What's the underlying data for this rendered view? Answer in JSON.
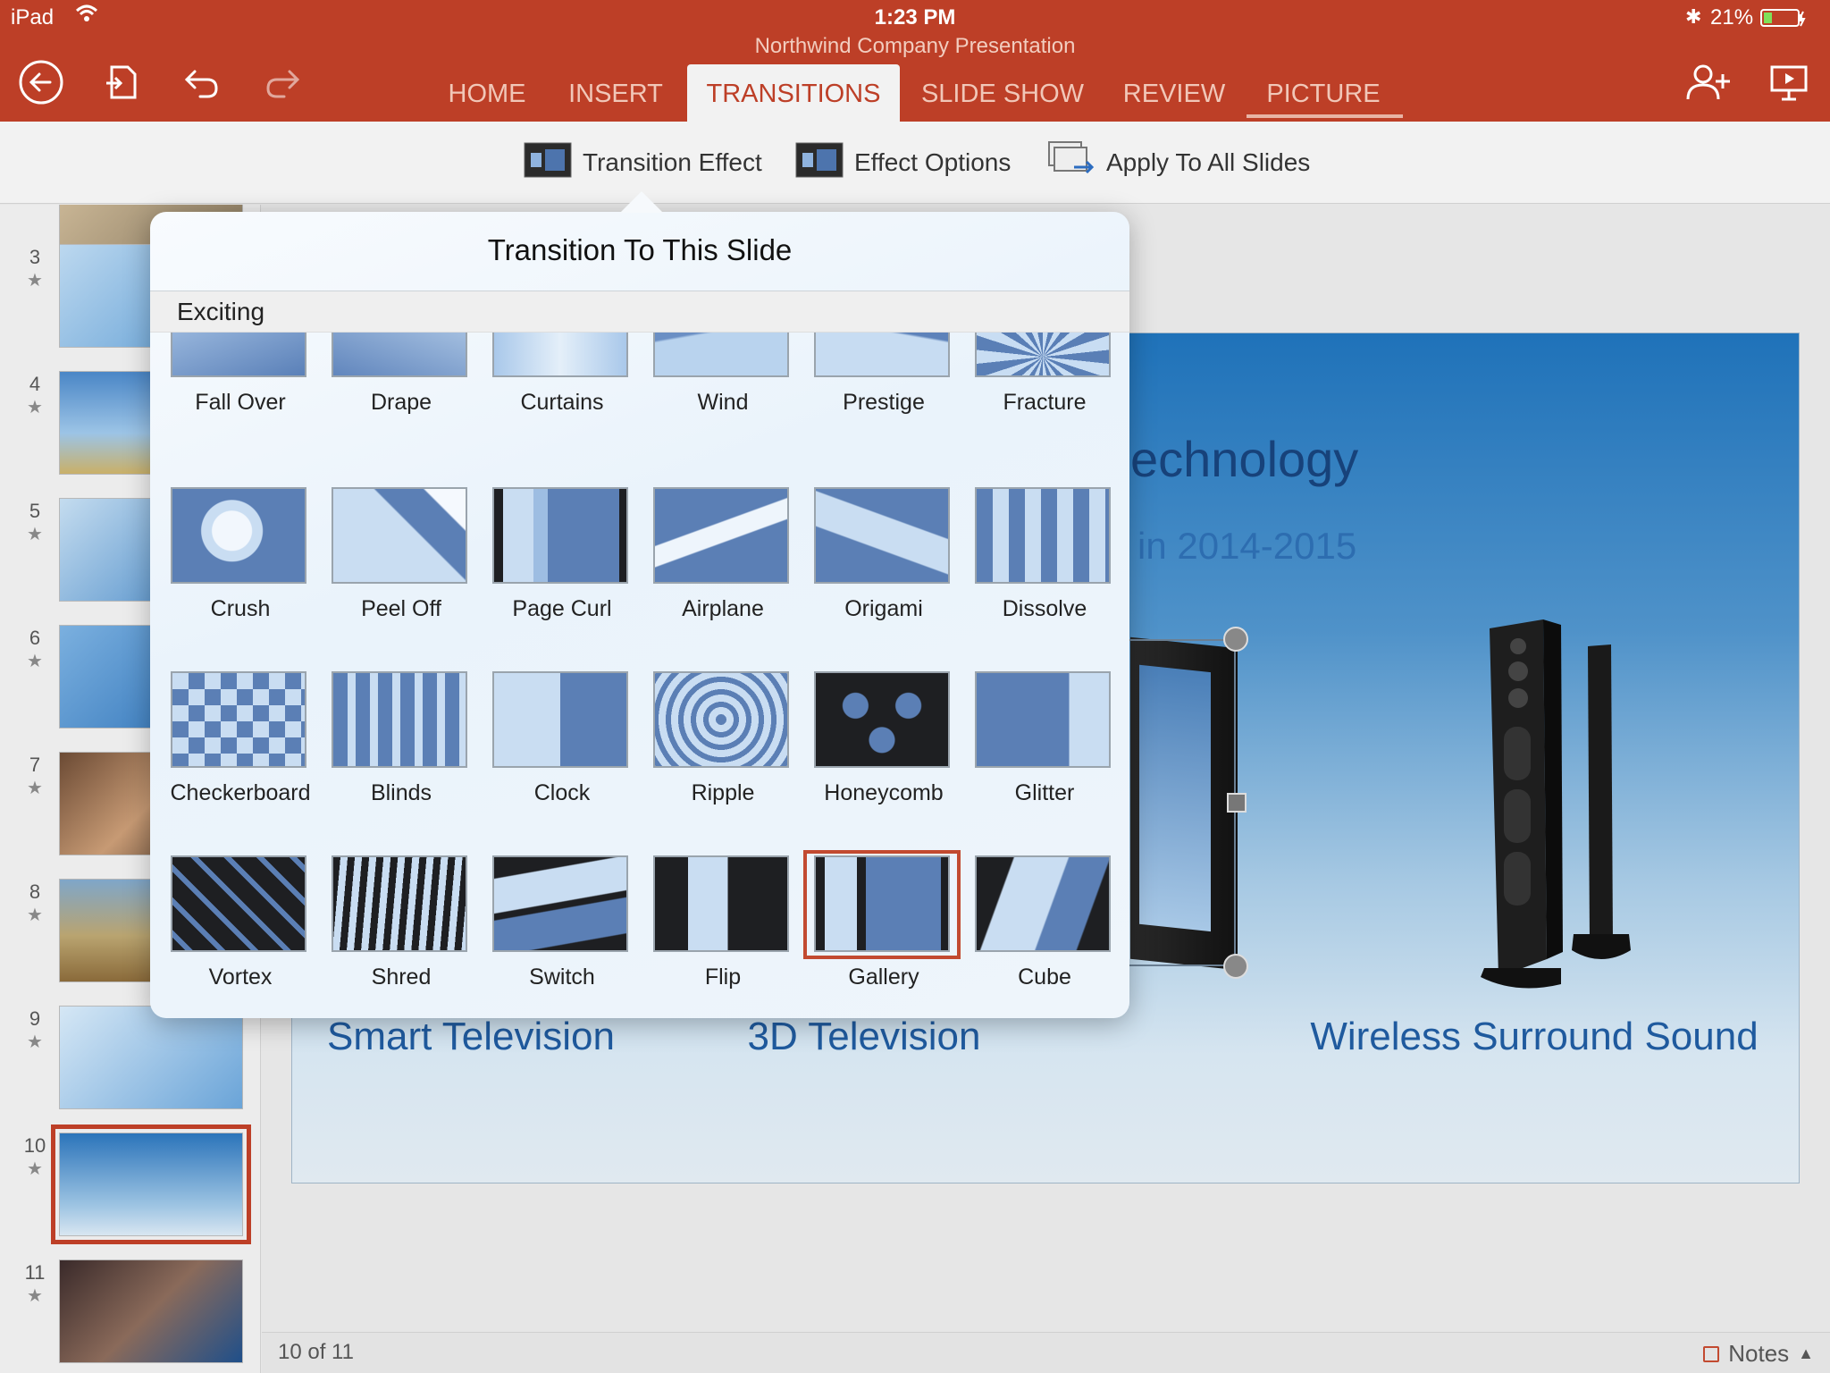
{
  "status_bar": {
    "device": "iPad",
    "time": "1:23 PM",
    "battery": "21%"
  },
  "app": {
    "document_title": "Northwind Company Presentation"
  },
  "tabs": [
    {
      "label": "HOME"
    },
    {
      "label": "INSERT"
    },
    {
      "label": "TRANSITIONS",
      "active": true
    },
    {
      "label": "SLIDE SHOW"
    },
    {
      "label": "REVIEW"
    },
    {
      "label": "PICTURE"
    }
  ],
  "ribbon": {
    "transition_effect": "Transition Effect",
    "effect_options": "Effect Options",
    "apply_all": "Apply To All Slides"
  },
  "thumbnails": [
    {
      "num": "3"
    },
    {
      "num": "4"
    },
    {
      "num": "5"
    },
    {
      "num": "6"
    },
    {
      "num": "7"
    },
    {
      "num": "8"
    },
    {
      "num": "9"
    },
    {
      "num": "10",
      "selected": true
    },
    {
      "num": "11"
    }
  ],
  "slide": {
    "title_fragment": "echnology",
    "subtitle_fragment": "in 2014-2015",
    "products": [
      "Smart Television",
      "3D Television",
      "Wireless Surround Sound"
    ]
  },
  "popover": {
    "title": "Transition To This Slide",
    "section": "Exciting",
    "items": [
      "Fall Over",
      "Drape",
      "Curtains",
      "Wind",
      "Prestige",
      "Fracture",
      "Crush",
      "Peel Off",
      "Page Curl",
      "Airplane",
      "Origami",
      "Dissolve",
      "Checkerboard",
      "Blinds",
      "Clock",
      "Ripple",
      "Honeycomb",
      "Glitter",
      "Vortex",
      "Shred",
      "Switch",
      "Flip",
      "Gallery",
      "Cube"
    ],
    "selected": "Gallery"
  },
  "footer": {
    "page": "10 of 11",
    "notes": "Notes"
  },
  "colors": {
    "accent": "#bd3f27",
    "selection": "#c24a30",
    "slide_text": "#1f5a9e"
  }
}
